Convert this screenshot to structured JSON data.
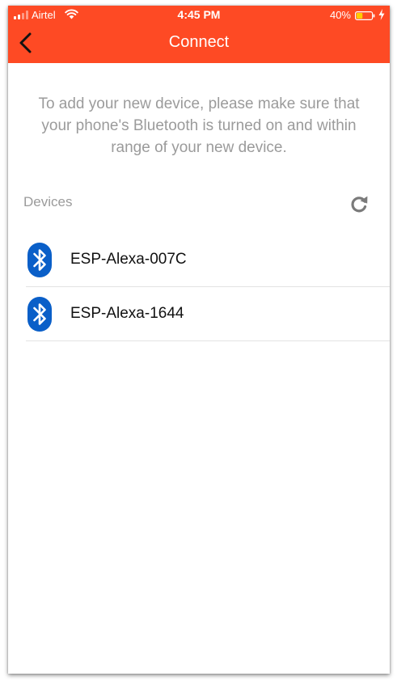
{
  "status_bar": {
    "carrier": "Airtel",
    "time": "4:45 PM",
    "battery_percent": "40%",
    "battery_level": 0.4,
    "icons": [
      "signal-icon",
      "wifi-icon",
      "battery-icon",
      "charging-bolt-icon"
    ]
  },
  "header": {
    "title": "Connect",
    "back_icon": "chevron-left-icon",
    "background_color": "#fe4a24"
  },
  "instructions": "To add your new device, please make sure that your phone's Bluetooth is turned on and within range of your new device.",
  "devices_section": {
    "label": "Devices",
    "refresh_icon": "refresh-icon",
    "items": [
      {
        "name": "ESP-Alexa-007C",
        "icon": "bluetooth-icon"
      },
      {
        "name": "ESP-Alexa-1644",
        "icon": "bluetooth-icon"
      }
    ]
  },
  "colors": {
    "accent": "#fe4a24",
    "bluetooth": "#0a5fc8",
    "muted_text": "#9b9b9b"
  }
}
